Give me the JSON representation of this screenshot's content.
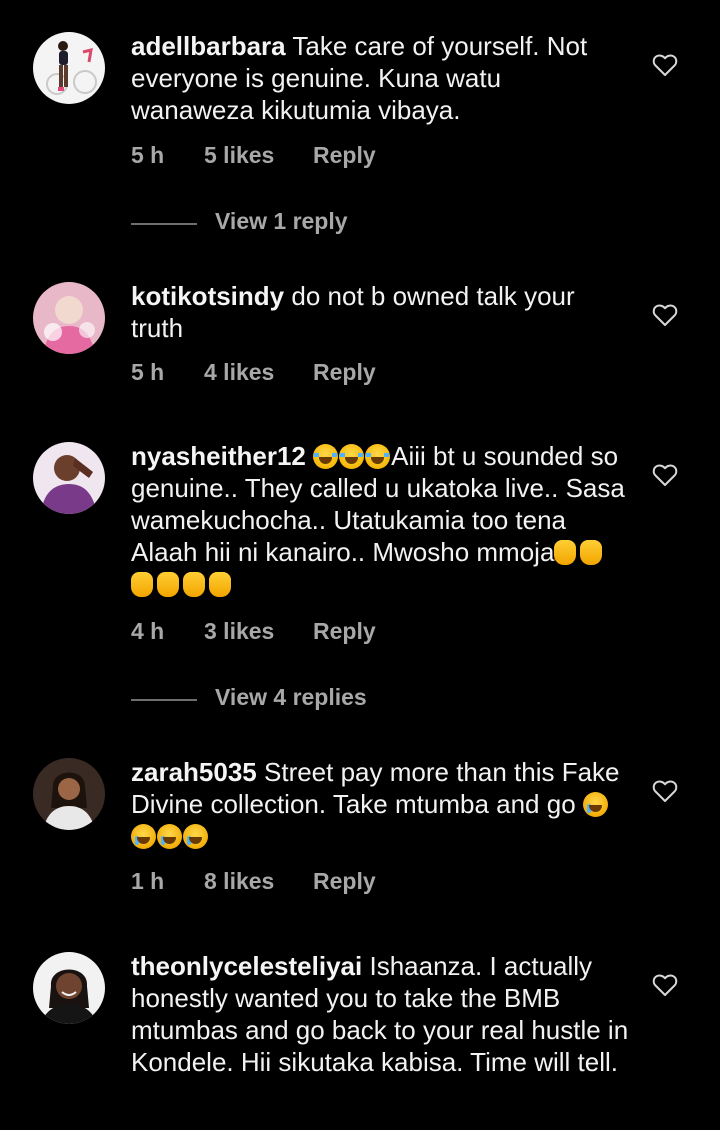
{
  "comments": [
    {
      "username": "adellbarbara",
      "text": "Take care of yourself. Not everyone is genuine. Kuna watu wanaweza kikutumia vibaya.",
      "time": "5 h",
      "likes": "5 likes",
      "reply": "Reply",
      "view_replies": "View 1 reply"
    },
    {
      "username": "kotikotsindy",
      "text": "do not b owned talk your truth",
      "time": "5 h",
      "likes": "4 likes",
      "reply": "Reply"
    },
    {
      "username": "nyasheither12",
      "text": "Aiii bt u sounded so genuine.. They called u ukatoka live.. Sasa wamekuchocha.. Utatukamia too tena Alaah hii ni kanairo.. Mwosho mmoja",
      "time": "4 h",
      "likes": "3 likes",
      "reply": "Reply",
      "view_replies": "View 4 replies"
    },
    {
      "username": "zarah5035",
      "text": "Street pay more than this Fake Divine collection. Take mtumba and go",
      "time": "1 h",
      "likes": "8 likes",
      "reply": "Reply"
    },
    {
      "username": "theonlycelesteliyai",
      "text": "Ishaanza. I actually honestly wanted you to take the BMB mtumbas and go back to your real hustle in Kondele. Hii sikutaka kabisa. Time will tell."
    }
  ],
  "icons": {
    "like": "heart-outline-icon",
    "laugh": "face-with-tears-of-joy-emoji",
    "cry": "crying-face-emoji",
    "clap": "raised-hands-emoji"
  },
  "colors": {
    "background": "#000000",
    "text": "#f5f5f5",
    "meta": "#a8a8a8"
  }
}
